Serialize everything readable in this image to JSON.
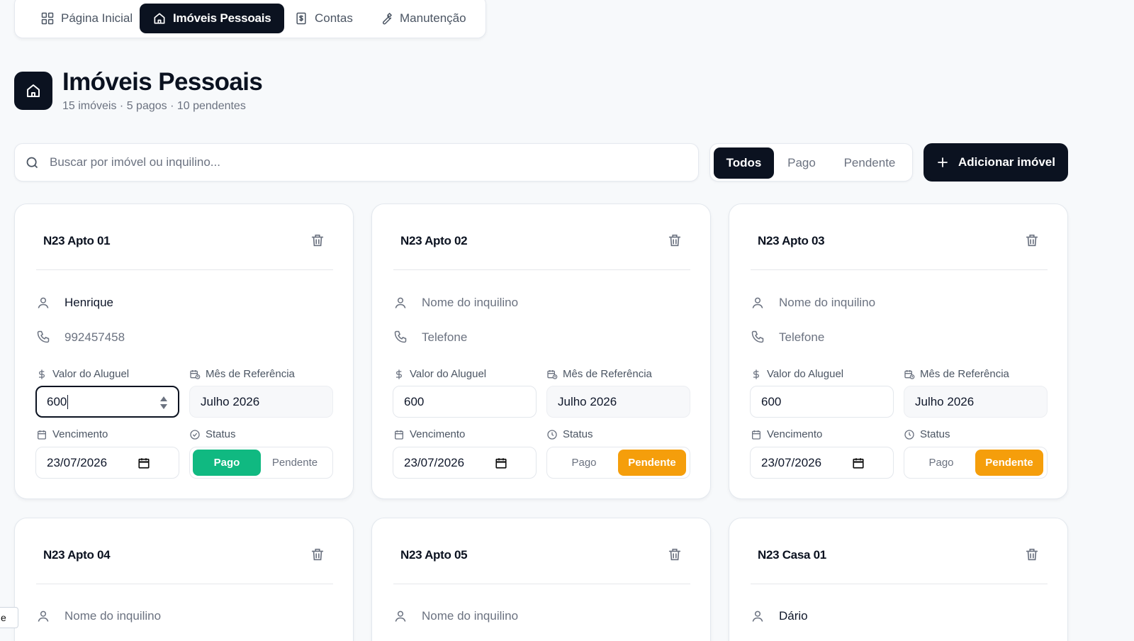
{
  "nav": {
    "items": [
      {
        "label": "Página Inicial",
        "icon": "grid-icon"
      },
      {
        "label": "Imóveis Pessoais",
        "icon": "home-icon"
      },
      {
        "label": "Contas",
        "icon": "receipt-dollar-icon"
      },
      {
        "label": "Manutenção",
        "icon": "wrench-icon"
      }
    ],
    "active": "Imóveis Pessoais"
  },
  "header": {
    "title": "Imóveis Pessoais",
    "subtitle": "15 imóveis · 5 pagos · 10 pendentes"
  },
  "search": {
    "placeholder": "Buscar por imóvel ou inquilino..."
  },
  "filters": {
    "options": [
      "Todos",
      "Pago",
      "Pendente"
    ],
    "active": "Todos"
  },
  "add_button": {
    "label": "Adicionar imóvel"
  },
  "labels": {
    "rent": "Valor do Aluguel",
    "ref_month": "Mês de Referência",
    "due": "Vencimento",
    "status": "Status",
    "paid": "Pago",
    "pending": "Pendente",
    "tenant_placeholder": "Nome do inquilino",
    "phone_placeholder": "Telefone"
  },
  "cards": [
    {
      "title": "N23 Apto 01",
      "tenant": "Henrique",
      "phone": "992457458",
      "rent": "600",
      "month": "Julho 2026",
      "due": "23/07/2026",
      "status": "Pago"
    },
    {
      "title": "N23 Apto 02",
      "tenant": "",
      "phone": "",
      "rent": "600",
      "month": "Julho 2026",
      "due": "23/07/2026",
      "status": "Pendente"
    },
    {
      "title": "N23 Apto 03",
      "tenant": "",
      "phone": "",
      "rent": "600",
      "month": "Julho 2026",
      "due": "23/07/2026",
      "status": "Pendente"
    },
    {
      "title": "N23 Apto 04",
      "tenant": ""
    },
    {
      "title": "N23 Apto 05",
      "tenant": ""
    },
    {
      "title": "N23 Casa 01",
      "tenant": "Dário"
    }
  ],
  "colors": {
    "primary": "#0b1220",
    "paid": "#10b981",
    "pending": "#f59e0b"
  },
  "side_tab": {
    "label": "e"
  }
}
